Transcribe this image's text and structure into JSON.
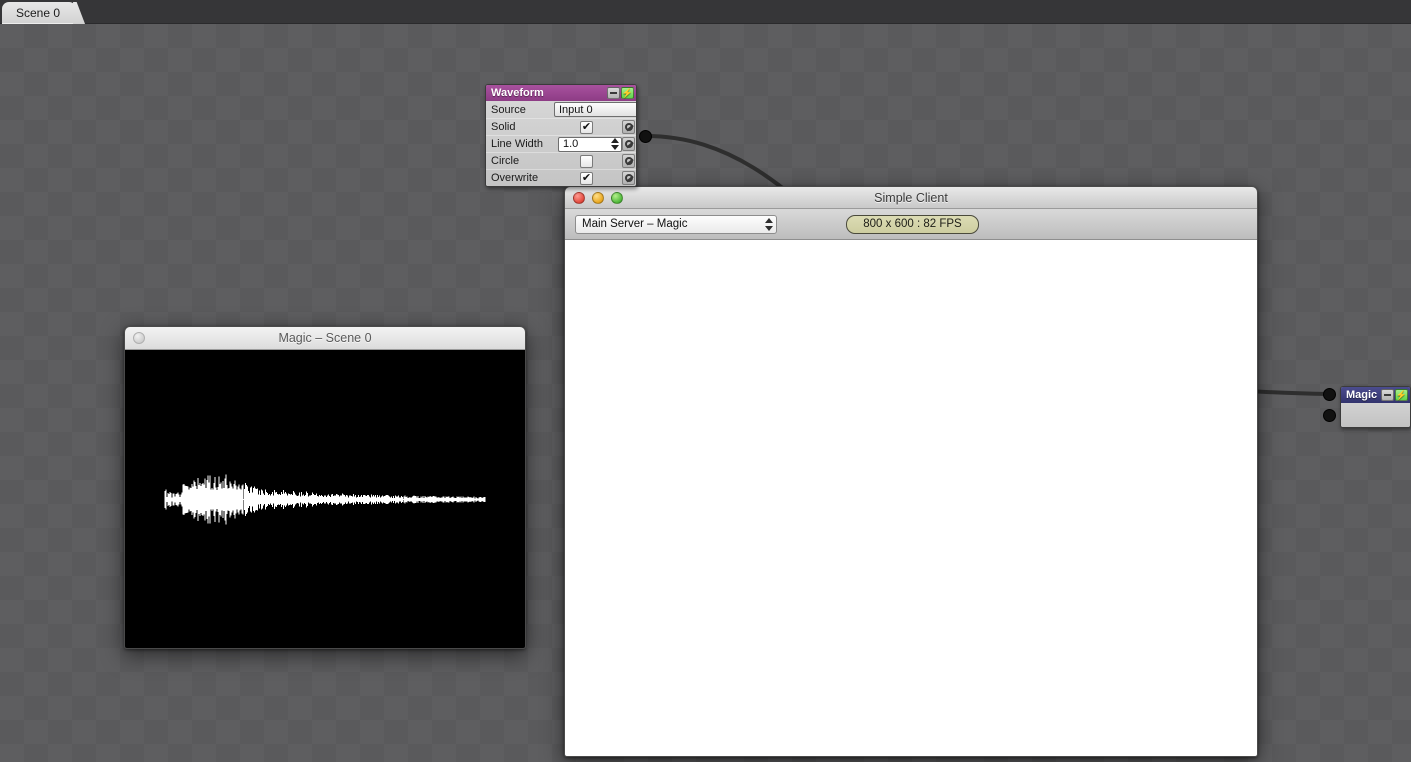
{
  "tabbar": {
    "tabs": [
      {
        "label": "Scene 0"
      }
    ]
  },
  "nodes": {
    "waveform": {
      "title": "Waveform",
      "minimize_label": "minimize",
      "bolt_label": "⚡",
      "rows": [
        {
          "label": "Source",
          "type": "select",
          "value": "Input 0"
        },
        {
          "label": "Solid",
          "type": "checkbox",
          "value": "✔",
          "checked": true
        },
        {
          "label": "Line Width",
          "type": "spinner",
          "value": "1.0"
        },
        {
          "label": "Circle",
          "type": "checkbox",
          "value": "",
          "checked": false
        },
        {
          "label": "Overwrite",
          "type": "checkbox",
          "value": "✔",
          "checked": true
        }
      ]
    },
    "magic": {
      "title": "Magic",
      "minimize_label": "minimize",
      "bolt_label": "⚡"
    }
  },
  "windows": {
    "simple_client": {
      "title": "Simple Client",
      "server_select": "Main Server – Magic",
      "fps_badge": "800 x 600 : 82 FPS",
      "lights": [
        "close",
        "minimize",
        "zoom"
      ]
    },
    "scene_viewer": {
      "title": "Magic – Scene 0",
      "lights": [
        "close"
      ]
    }
  },
  "colors": {
    "waveform_title": "#8d3c85",
    "magic_title": "#33346e",
    "bolt_green": "#5fd44a",
    "fps_badge": "#cdcda0",
    "canvas_checker_a": "#5e5e60",
    "canvas_checker_b": "#5a5a5c",
    "scene_background": "#000000",
    "waveform_trace": "#ffffff"
  }
}
